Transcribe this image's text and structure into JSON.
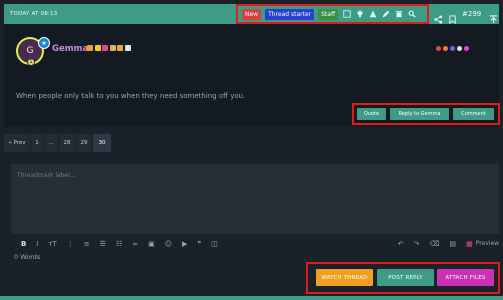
{
  "header": {
    "date": "TODAY AT 08:13",
    "badges": {
      "new": "New",
      "thread_starter": "Thread starter",
      "staff": "Staff"
    },
    "post_number": "#299"
  },
  "post": {
    "username": "Gemma",
    "avatar_initial": "G",
    "message": "When people only talk to you when they need something off you.",
    "actions": {
      "quote": "Quote",
      "reply": "Reply to Gemma",
      "comment": "Comment"
    }
  },
  "pagination": {
    "prev": "« Prev",
    "pages": [
      "1",
      "...",
      "28",
      "29",
      "30"
    ],
    "current": "30"
  },
  "editor": {
    "placeholder": "Threadmark label...",
    "word_count": "0 Words",
    "preview_label": "Preview",
    "toolbar": {
      "bold": "B",
      "italic": "I",
      "text_size": "тT"
    }
  },
  "bottom_actions": {
    "watch": "WATCH THREAD",
    "post_reply": "POST REPLY",
    "attach": "ATTACH FILES"
  },
  "colors": {
    "accent": "#3d9b86",
    "watch": "#f0a020",
    "attach": "#cc30b5",
    "annotation": "#e01b1b"
  }
}
